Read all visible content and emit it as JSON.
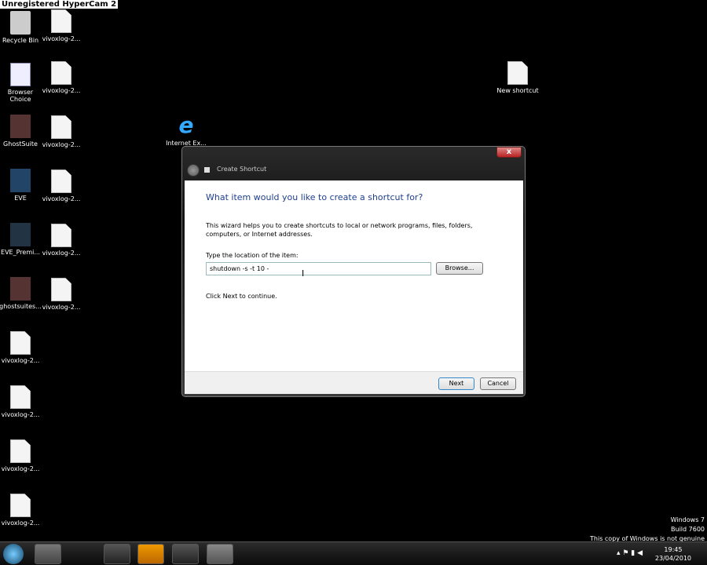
{
  "watermark": "Unregistered HyperCam 2",
  "desktop": {
    "icons": [
      "Recycle Bin",
      "Browser Choice",
      "GhostSuite",
      "EVE",
      "EVE_Premi...",
      "ghostsuites...",
      "vivoxlog-2...",
      "vivoxlog-2...",
      "vivoxlog-2...",
      "vivoxlog-2...",
      "vivoxlog-2...",
      "vivoxlog-2...",
      "vivoxlog-2...",
      "vivoxlog-2...",
      "vivoxlog-2...",
      "vivoxlog-2...",
      "Internet Ex...",
      "New shortcut"
    ]
  },
  "dialog": {
    "title": "Create Shortcut",
    "close": "x",
    "heading": "What item would you like to create a shortcut for?",
    "description": "This wizard helps you to create shortcuts to local or network programs, files, folders, computers, or Internet addresses.",
    "location_label": "Type the location of the item:",
    "location_value": "shutdown -s -t 10 -",
    "browse": "Browse...",
    "hint": "Click Next to continue.",
    "next": "Next",
    "cancel": "Cancel"
  },
  "genuine": {
    "line1": "Windows 7",
    "line2": "Build 7600",
    "line3": "This copy of Windows is not genuine"
  },
  "tray": {
    "time": "19:45",
    "date": "23/04/2010"
  }
}
